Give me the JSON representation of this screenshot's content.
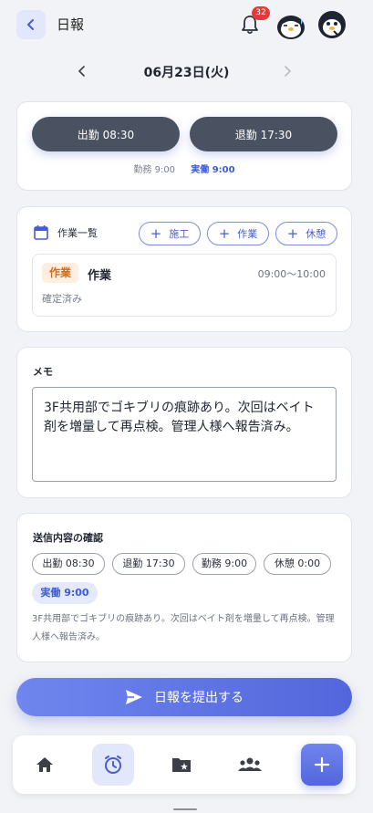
{
  "header": {
    "title": "日報",
    "notification_count": "32"
  },
  "date_nav": {
    "date": "06月23日(火)"
  },
  "attendance": {
    "clock_in": "出勤 08:30",
    "clock_out": "退勤 17:30",
    "work": "勤務 9:00",
    "actual": "実働 9:00"
  },
  "tasks": {
    "title": "作業一覧",
    "add_construction": "施工",
    "add_work": "作業",
    "add_break": "休憩",
    "items": [
      {
        "badge": "作業",
        "name": "作業",
        "time": "09:00〜10:00",
        "status": "確定済み"
      }
    ]
  },
  "memo": {
    "label": "メモ",
    "text": "3F共用部でゴキブリの痕跡あり。次回はベイト剤を増量して再点検。管理人様へ報告済み。"
  },
  "confirm": {
    "title": "送信内容の確認",
    "clock_in": "出勤 08:30",
    "clock_out": "退勤 17:30",
    "work": "勤務 9:00",
    "break": "休憩 0:00",
    "actual": "実働 9:00",
    "memo": "3F共用部でゴキブリの痕跡あり。次回はベイト剤を増量して再点検。管理人様へ報告済み。"
  },
  "submit": {
    "label": "日報を提出する"
  },
  "tabbar": {
    "active": "clock",
    "icons": [
      "home-icon",
      "alarm-clock-icon",
      "folder-star-icon",
      "group-icon",
      "plus-icon"
    ]
  },
  "colors": {
    "accent": "#5366dc",
    "dark_button": "#4a5262",
    "badge_red": "#e03a3a",
    "task_badge": "#d46b17"
  }
}
